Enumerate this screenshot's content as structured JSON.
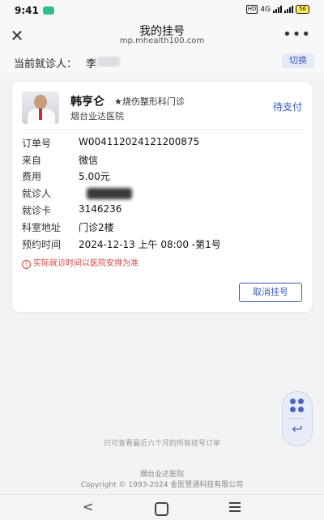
{
  "status_bar": {
    "time": "9:41",
    "network": "HD",
    "signal": "4G",
    "battery": "56"
  },
  "titlebar": {
    "title": "我的挂号",
    "url": "mp.mhealth100.com",
    "close_icon": "close-icon",
    "more_icon": "more-icon"
  },
  "patient": {
    "label": "当前就诊人：",
    "name": "李",
    "switch_label": "切换"
  },
  "card": {
    "doctor_name": "韩亨仑",
    "department": "★烧伤整形科门诊",
    "hospital": "烟台业达医院",
    "status": "待支付",
    "rows": [
      {
        "key": "订单号",
        "value": "W004112024121200875"
      },
      {
        "key": "来自",
        "value": "微信"
      },
      {
        "key": "费用",
        "value": "5.00元"
      },
      {
        "key": "就诊人",
        "value": ""
      },
      {
        "key": "就诊卡",
        "value": "3146236"
      },
      {
        "key": "科室地址",
        "value": "门诊2楼"
      },
      {
        "key": "预约时间",
        "value": "2024-12-13 上午 08:00 -第1号"
      }
    ],
    "notice": "实际就诊时间以医院安排为准",
    "notice_icon": "!",
    "cancel_label": "取消挂号"
  },
  "float_widget": {
    "menu_icon": "grid-icon",
    "back_icon": "↩"
  },
  "history_note": "只可查看最近六个月的所有挂号订单",
  "footer": {
    "hospital": "烟台业达医院",
    "copyright": "Copyright © 1993-2024 金医慧通科技有限公司"
  },
  "nav": {
    "back": "<"
  }
}
